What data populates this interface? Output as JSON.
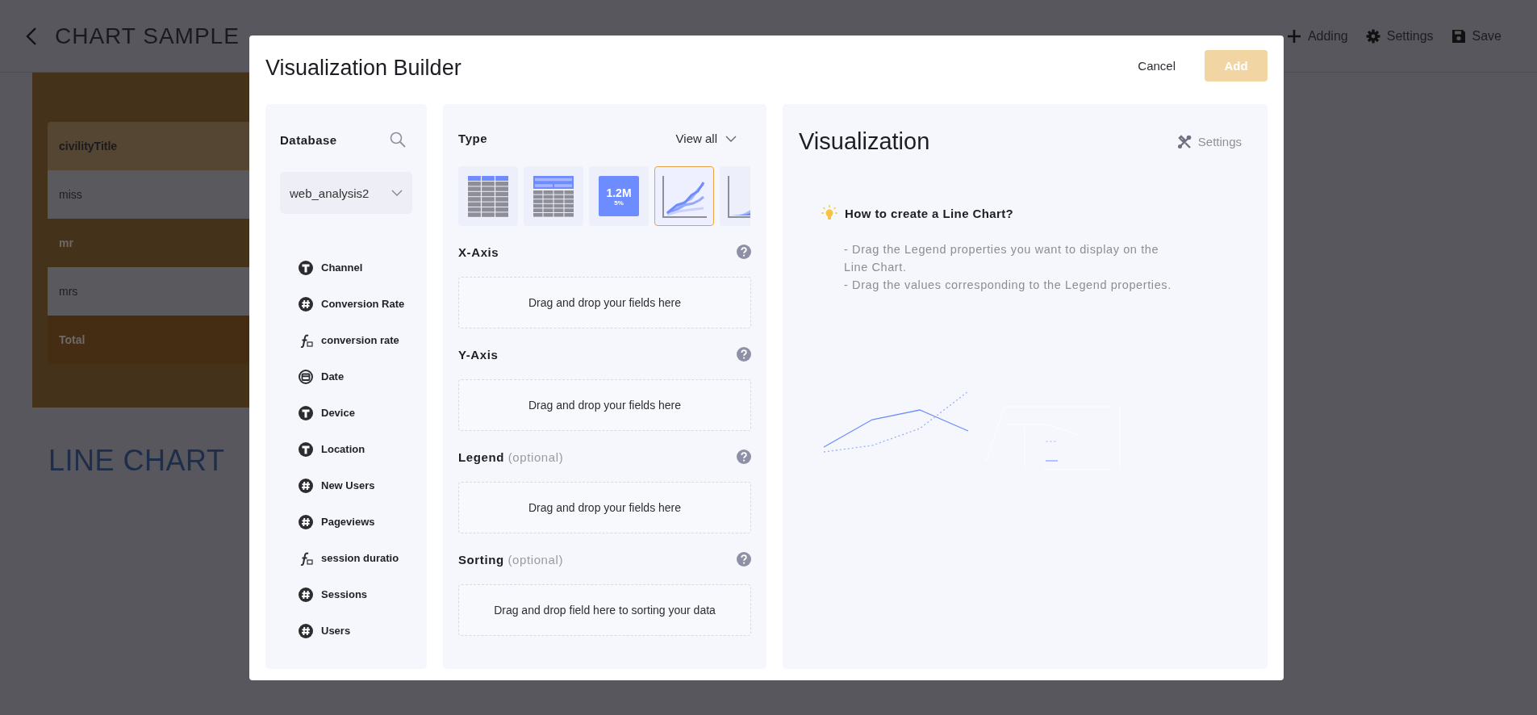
{
  "page": {
    "title": "CHART SAMPLE",
    "toolbar": [
      {
        "label": "Adding"
      },
      {
        "label": "Settings"
      },
      {
        "label": "Save"
      }
    ],
    "table": {
      "column": "civilityTitle",
      "rows": [
        {
          "label": "miss",
          "kind": "light"
        },
        {
          "label": "mr",
          "kind": "dark"
        },
        {
          "label": "mrs",
          "kind": "light"
        },
        {
          "label": "Total",
          "kind": "total"
        }
      ]
    },
    "section_title": "LINE CHART"
  },
  "dialog": {
    "title": "Visualization Builder",
    "cancel": "Cancel",
    "add": {
      "label": "Add",
      "disabled": true
    }
  },
  "database": {
    "title": "Database",
    "source": "web_analysis2",
    "fields": [
      {
        "name": "Channel",
        "kind": "text"
      },
      {
        "name": "Conversion Rate",
        "kind": "number"
      },
      {
        "name": "conversion rate",
        "kind": "formula"
      },
      {
        "name": "Date",
        "kind": "date"
      },
      {
        "name": "Device",
        "kind": "text"
      },
      {
        "name": "Location",
        "kind": "text"
      },
      {
        "name": "New Users",
        "kind": "number"
      },
      {
        "name": "Pageviews",
        "kind": "number"
      },
      {
        "name": "session duratio",
        "kind": "formula"
      },
      {
        "name": "Sessions",
        "kind": "number"
      },
      {
        "name": "Users",
        "kind": "number"
      }
    ]
  },
  "type": {
    "title": "Type",
    "view_all": "View all",
    "options": [
      {
        "kind": "table",
        "selected": false
      },
      {
        "kind": "pivot",
        "selected": false
      },
      {
        "kind": "kpi",
        "value": "1.2M",
        "change": "5%",
        "selected": false
      },
      {
        "kind": "line",
        "selected": true
      },
      {
        "kind": "area",
        "selected": false
      }
    ]
  },
  "sections": [
    {
      "title": "X-Axis",
      "hint": "Drag and drop your fields here"
    },
    {
      "title": "Y-Axis",
      "hint": "Drag and drop your fields here"
    },
    {
      "title": "Legend",
      "note": "(optional)",
      "hint": "Drag and drop your fields here"
    },
    {
      "title": "Sorting",
      "note": "(optional)",
      "hint": "Drag and drop field here to sorting your data"
    }
  ],
  "visualization": {
    "title": "Visualization",
    "settings": "Settings",
    "tip_title": "How to create a Line Chart?",
    "tip_lines": [
      "- Drag the Legend properties you want to display on the Line Chart.",
      "- Drag the values corresponding to the Legend properties."
    ]
  }
}
